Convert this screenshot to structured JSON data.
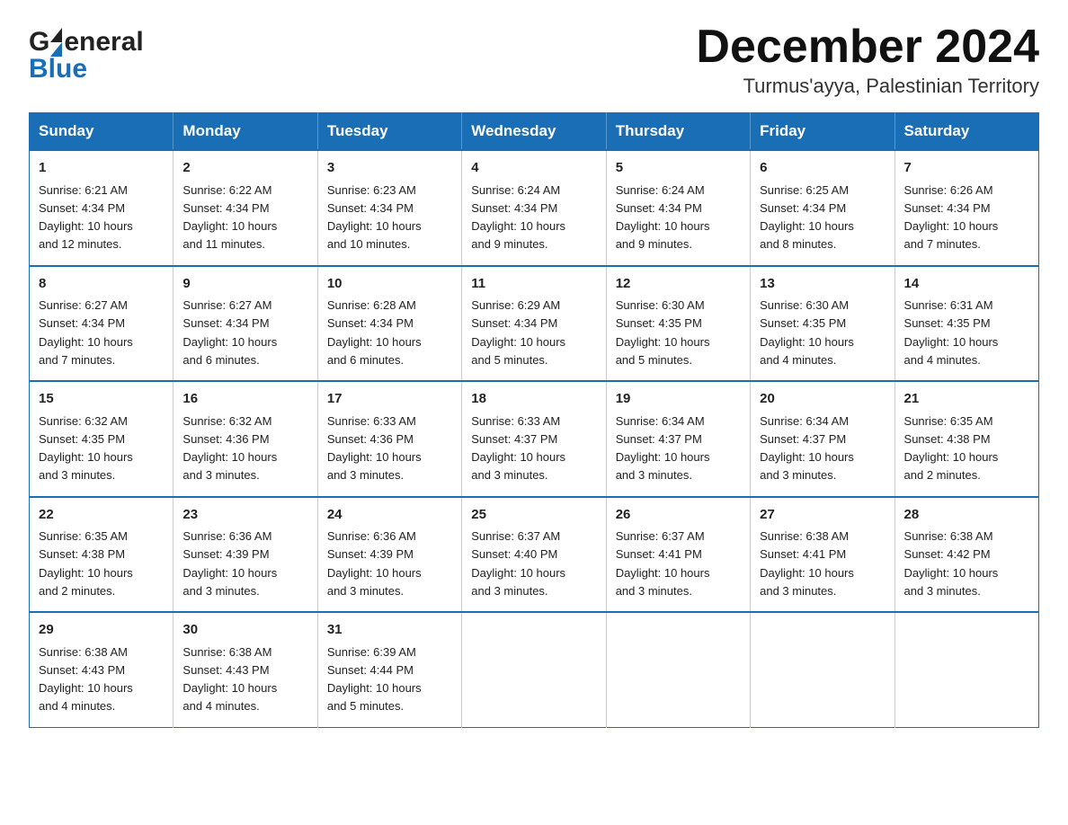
{
  "header": {
    "month_title": "December 2024",
    "subtitle": "Turmus'ayya, Palestinian Territory"
  },
  "days_of_week": [
    "Sunday",
    "Monday",
    "Tuesday",
    "Wednesday",
    "Thursday",
    "Friday",
    "Saturday"
  ],
  "weeks": [
    [
      {
        "day": "1",
        "sunrise": "6:21 AM",
        "sunset": "4:34 PM",
        "daylight": "10 hours and 12 minutes."
      },
      {
        "day": "2",
        "sunrise": "6:22 AM",
        "sunset": "4:34 PM",
        "daylight": "10 hours and 11 minutes."
      },
      {
        "day": "3",
        "sunrise": "6:23 AM",
        "sunset": "4:34 PM",
        "daylight": "10 hours and 10 minutes."
      },
      {
        "day": "4",
        "sunrise": "6:24 AM",
        "sunset": "4:34 PM",
        "daylight": "10 hours and 9 minutes."
      },
      {
        "day": "5",
        "sunrise": "6:24 AM",
        "sunset": "4:34 PM",
        "daylight": "10 hours and 9 minutes."
      },
      {
        "day": "6",
        "sunrise": "6:25 AM",
        "sunset": "4:34 PM",
        "daylight": "10 hours and 8 minutes."
      },
      {
        "day": "7",
        "sunrise": "6:26 AM",
        "sunset": "4:34 PM",
        "daylight": "10 hours and 7 minutes."
      }
    ],
    [
      {
        "day": "8",
        "sunrise": "6:27 AM",
        "sunset": "4:34 PM",
        "daylight": "10 hours and 7 minutes."
      },
      {
        "day": "9",
        "sunrise": "6:27 AM",
        "sunset": "4:34 PM",
        "daylight": "10 hours and 6 minutes."
      },
      {
        "day": "10",
        "sunrise": "6:28 AM",
        "sunset": "4:34 PM",
        "daylight": "10 hours and 6 minutes."
      },
      {
        "day": "11",
        "sunrise": "6:29 AM",
        "sunset": "4:34 PM",
        "daylight": "10 hours and 5 minutes."
      },
      {
        "day": "12",
        "sunrise": "6:30 AM",
        "sunset": "4:35 PM",
        "daylight": "10 hours and 5 minutes."
      },
      {
        "day": "13",
        "sunrise": "6:30 AM",
        "sunset": "4:35 PM",
        "daylight": "10 hours and 4 minutes."
      },
      {
        "day": "14",
        "sunrise": "6:31 AM",
        "sunset": "4:35 PM",
        "daylight": "10 hours and 4 minutes."
      }
    ],
    [
      {
        "day": "15",
        "sunrise": "6:32 AM",
        "sunset": "4:35 PM",
        "daylight": "10 hours and 3 minutes."
      },
      {
        "day": "16",
        "sunrise": "6:32 AM",
        "sunset": "4:36 PM",
        "daylight": "10 hours and 3 minutes."
      },
      {
        "day": "17",
        "sunrise": "6:33 AM",
        "sunset": "4:36 PM",
        "daylight": "10 hours and 3 minutes."
      },
      {
        "day": "18",
        "sunrise": "6:33 AM",
        "sunset": "4:37 PM",
        "daylight": "10 hours and 3 minutes."
      },
      {
        "day": "19",
        "sunrise": "6:34 AM",
        "sunset": "4:37 PM",
        "daylight": "10 hours and 3 minutes."
      },
      {
        "day": "20",
        "sunrise": "6:34 AM",
        "sunset": "4:37 PM",
        "daylight": "10 hours and 3 minutes."
      },
      {
        "day": "21",
        "sunrise": "6:35 AM",
        "sunset": "4:38 PM",
        "daylight": "10 hours and 2 minutes."
      }
    ],
    [
      {
        "day": "22",
        "sunrise": "6:35 AM",
        "sunset": "4:38 PM",
        "daylight": "10 hours and 2 minutes."
      },
      {
        "day": "23",
        "sunrise": "6:36 AM",
        "sunset": "4:39 PM",
        "daylight": "10 hours and 3 minutes."
      },
      {
        "day": "24",
        "sunrise": "6:36 AM",
        "sunset": "4:39 PM",
        "daylight": "10 hours and 3 minutes."
      },
      {
        "day": "25",
        "sunrise": "6:37 AM",
        "sunset": "4:40 PM",
        "daylight": "10 hours and 3 minutes."
      },
      {
        "day": "26",
        "sunrise": "6:37 AM",
        "sunset": "4:41 PM",
        "daylight": "10 hours and 3 minutes."
      },
      {
        "day": "27",
        "sunrise": "6:38 AM",
        "sunset": "4:41 PM",
        "daylight": "10 hours and 3 minutes."
      },
      {
        "day": "28",
        "sunrise": "6:38 AM",
        "sunset": "4:42 PM",
        "daylight": "10 hours and 3 minutes."
      }
    ],
    [
      {
        "day": "29",
        "sunrise": "6:38 AM",
        "sunset": "4:43 PM",
        "daylight": "10 hours and 4 minutes."
      },
      {
        "day": "30",
        "sunrise": "6:38 AM",
        "sunset": "4:43 PM",
        "daylight": "10 hours and 4 minutes."
      },
      {
        "day": "31",
        "sunrise": "6:39 AM",
        "sunset": "4:44 PM",
        "daylight": "10 hours and 5 minutes."
      },
      null,
      null,
      null,
      null
    ]
  ],
  "labels": {
    "sunrise": "Sunrise:",
    "sunset": "Sunset:",
    "daylight": "Daylight:"
  },
  "logo": {
    "line1": "General",
    "line2": "Blue"
  }
}
